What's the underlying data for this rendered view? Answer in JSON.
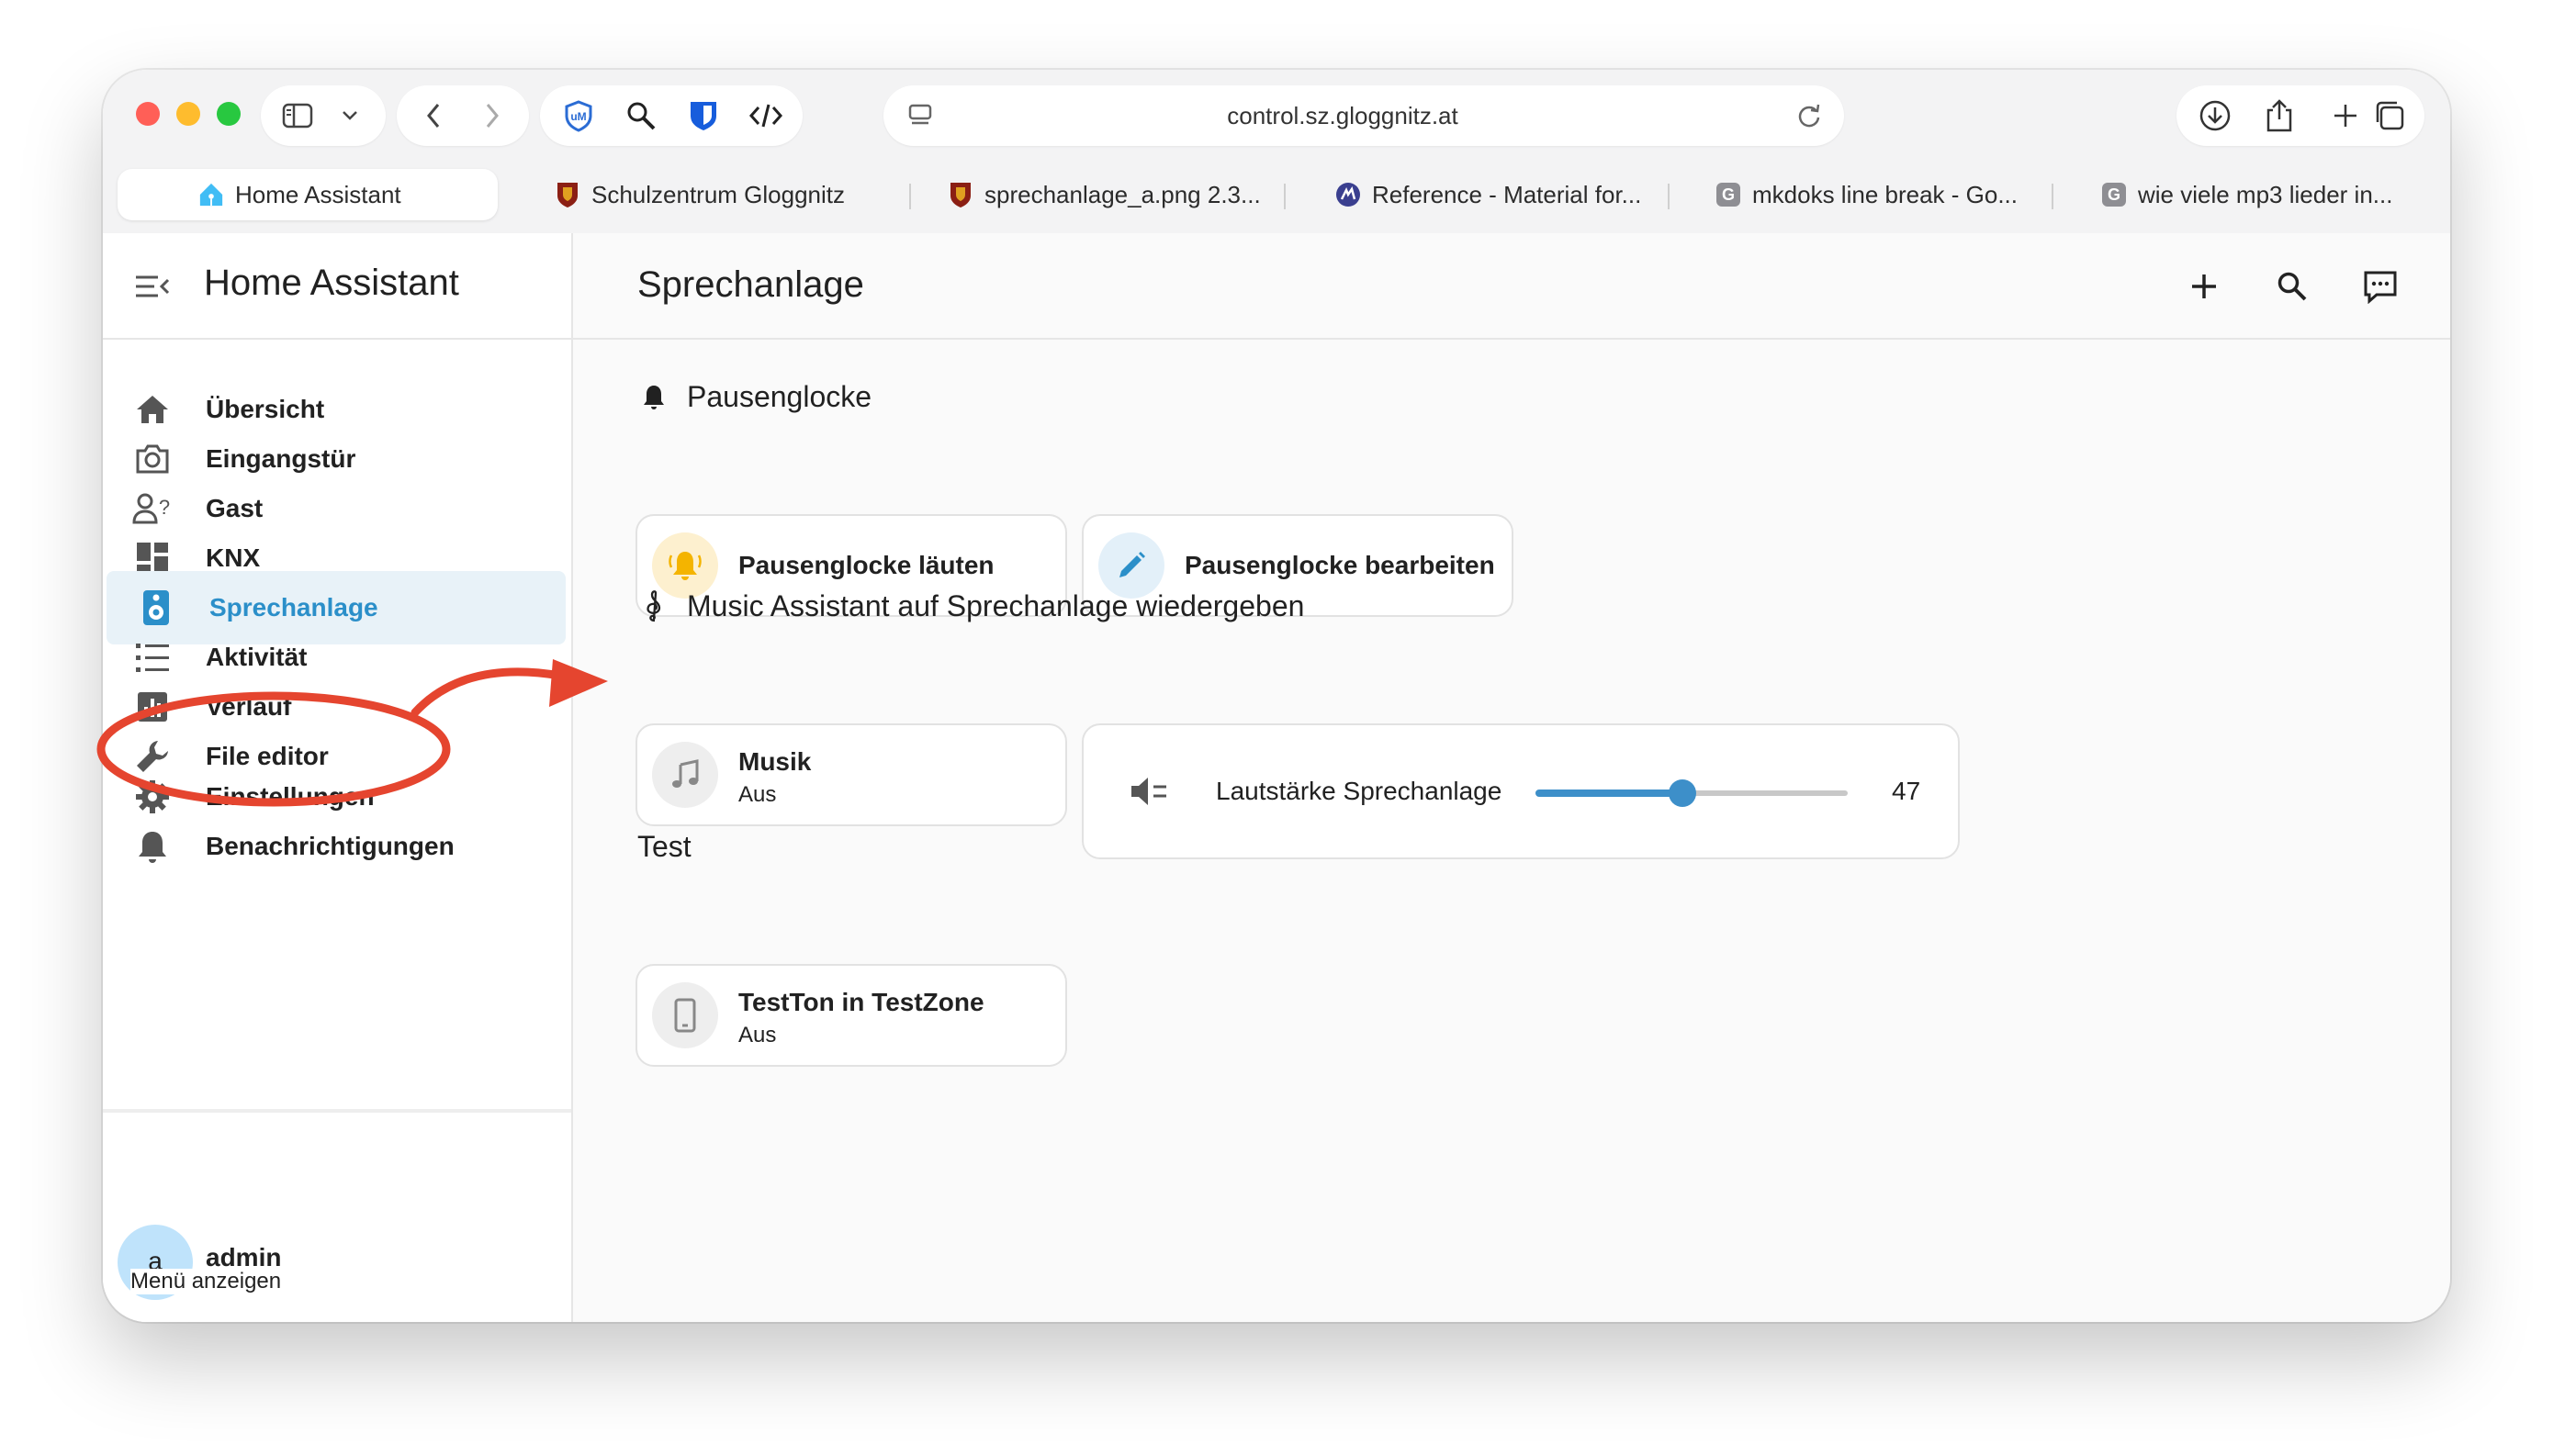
{
  "browser": {
    "url": "control.sz.gloggnitz.at",
    "tabs": [
      {
        "label": "Home Assistant",
        "icon": "home-assistant-icon",
        "active": true
      },
      {
        "label": "Schulzentrum Gloggnitz",
        "icon": "school-crest-icon"
      },
      {
        "label": "sprechanlage_a.png 2.3...",
        "icon": "school-crest-icon"
      },
      {
        "label": "Reference - Material for...",
        "icon": "material-logo-icon"
      },
      {
        "label": "mkdoks line break - Go...",
        "icon": "g-icon"
      },
      {
        "label": "wie viele mp3 lieder in...",
        "icon": "g-icon"
      }
    ],
    "g_glyph": "G"
  },
  "sidebar": {
    "title": "Home Assistant",
    "items": [
      {
        "label": "Übersicht",
        "icon": "home-icon"
      },
      {
        "label": "Eingangstür",
        "icon": "camera-icon"
      },
      {
        "label": "Gast",
        "icon": "account-question-icon"
      },
      {
        "label": "KNX",
        "icon": "view-dashboard-icon"
      },
      {
        "label": "Sprechanlage",
        "icon": "speaker-icon",
        "active": true
      },
      {
        "label": "Aktivität",
        "icon": "format-list-icon"
      },
      {
        "label": "Verlauf",
        "icon": "chart-box-icon"
      },
      {
        "label": "File editor",
        "icon": "wrench-icon"
      }
    ],
    "bottom_items": [
      {
        "label": "Einstellungen",
        "icon": "cog-icon"
      },
      {
        "label": "Benachrichtigungen",
        "icon": "bell-icon"
      }
    ],
    "user": {
      "initial": "a",
      "name": "admin"
    },
    "tooltip": "Menü anzeigen"
  },
  "main": {
    "title": "Sprechanlage",
    "sections": [
      {
        "title": "Pausenglocke",
        "icon": "bell-icon",
        "cards": [
          {
            "title": "Pausenglocke läuten",
            "icon": "bell-ring-icon",
            "icon_color": "#f4b400"
          },
          {
            "title": "Pausenglocke bearbeiten",
            "icon": "pencil-icon",
            "icon_color": "#2b8fc9"
          }
        ]
      },
      {
        "title": "Music Assistant auf Sprechanlage wiedergeben",
        "icon": "music-clef-treble-icon",
        "cards": [
          {
            "title": "Musik",
            "subtitle": "Aus",
            "icon": "music-note-icon"
          }
        ],
        "volume": {
          "label": "Lautstärke Sprechanlage",
          "value": "47",
          "level": 47,
          "icon": "volume-medium-icon"
        }
      },
      {
        "title": "Test",
        "cards": [
          {
            "title": "TestTon in TestZone",
            "subtitle": "Aus",
            "icon": "cellphone-icon"
          }
        ]
      }
    ]
  },
  "colors": {
    "accent": "#2b8fc9",
    "annotation": "#e5452f",
    "active_bg": "#e8f2f8"
  }
}
